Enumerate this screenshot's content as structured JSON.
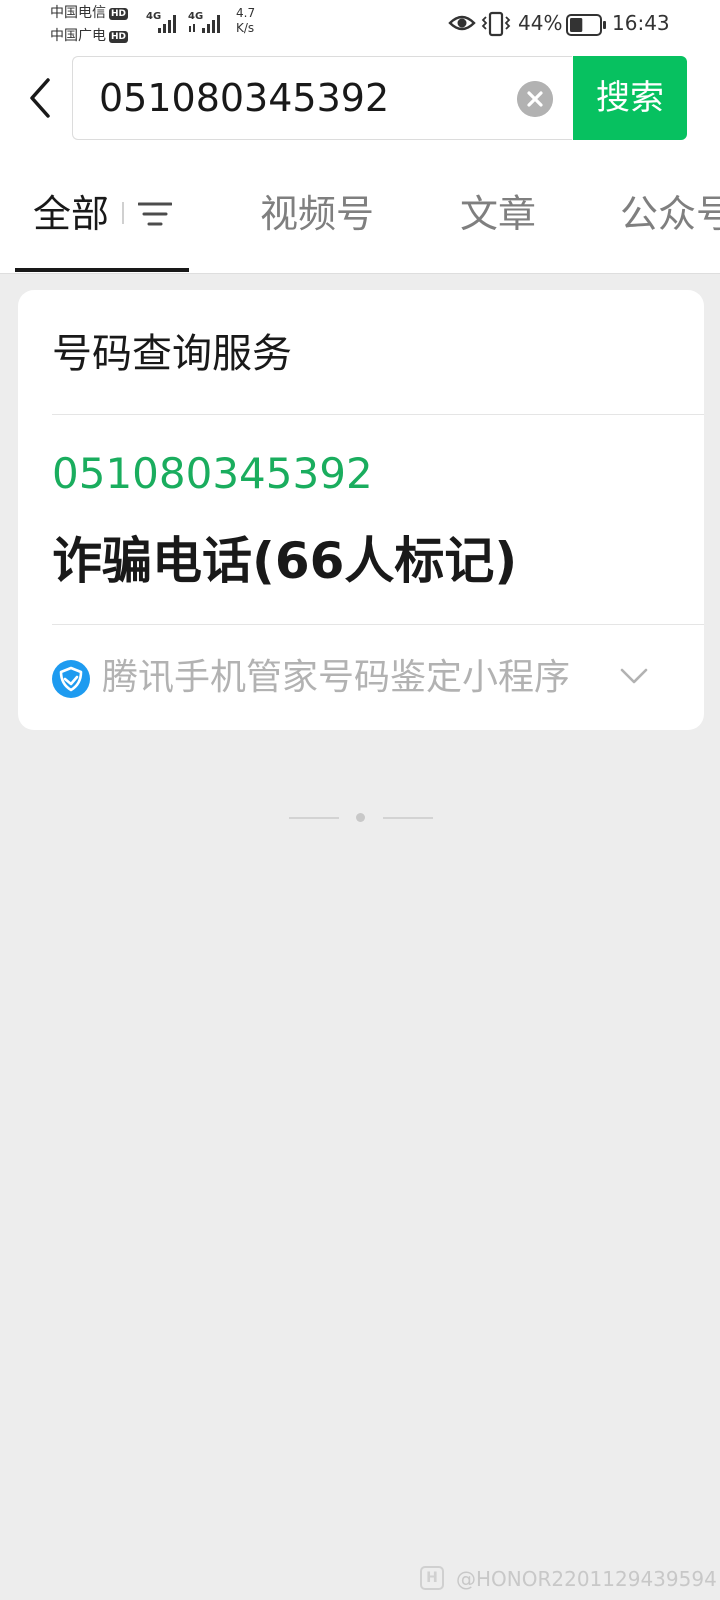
{
  "status_bar": {
    "carrier1": "中国电信",
    "carrier2": "中国广电",
    "hd_badge": "HD",
    "network1": "4G",
    "network2": "4G",
    "net_speed_value": "4.7",
    "net_speed_unit": "K/s",
    "battery_percent": "44%",
    "time": "16:43",
    "battery_level": 0.44
  },
  "search": {
    "query": "051080345392",
    "button_label": "搜索"
  },
  "tabs": [
    {
      "label": "全部",
      "selected": true
    },
    {
      "label": "视频号",
      "selected": false
    },
    {
      "label": "文章",
      "selected": false
    },
    {
      "label": "公众号",
      "selected": false
    }
  ],
  "result_card": {
    "title": "号码查询服务",
    "number": "051080345392",
    "label": "诈骗电话(66人标记)",
    "source": "腾讯手机管家号码鉴定小程序",
    "number_color": "#1aad5e",
    "source_icon_color": "#1e9bf0"
  },
  "watermark": {
    "icon_letter": "H",
    "text": "@HONOR2201129439594"
  },
  "colors": {
    "accent": "#07c160",
    "background": "#ededed"
  }
}
